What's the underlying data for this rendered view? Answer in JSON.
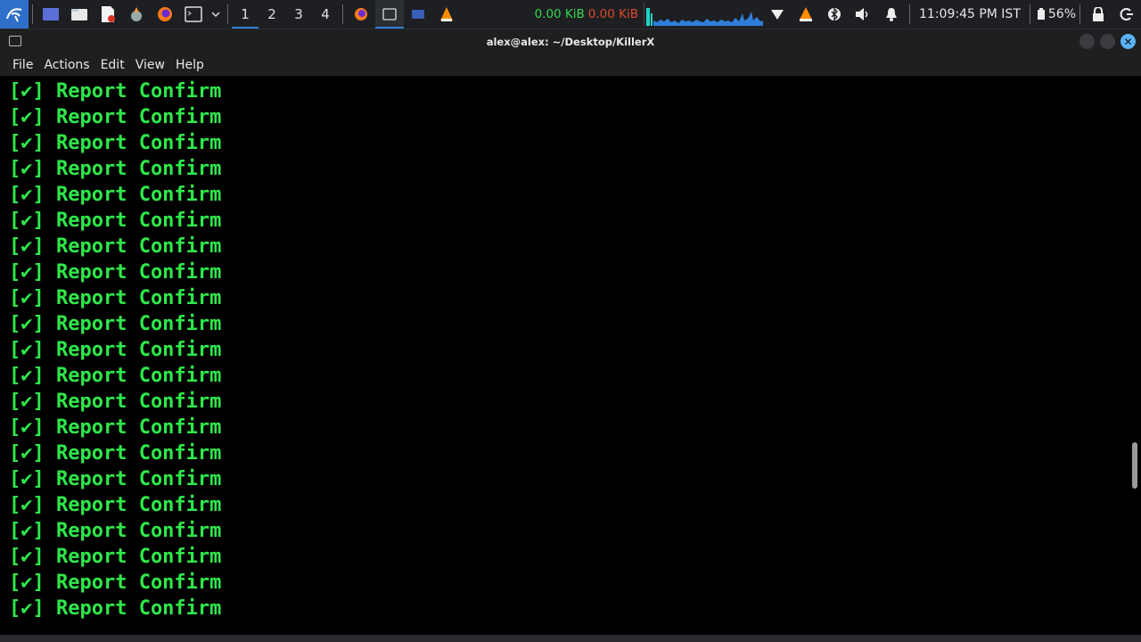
{
  "panel": {
    "workspaces": [
      "1",
      "2",
      "3",
      "4"
    ],
    "active_workspace": "1",
    "net_up": "0.00 KiB",
    "net_down": "0.00 KiB",
    "clock": "11:09:45 PM IST",
    "battery": "56%",
    "colors": {
      "accent": "#2f7fd9",
      "net_up": "#35d64e",
      "net_down": "#e04a2f"
    }
  },
  "window": {
    "title": "alex@alex: ~/Desktop/KillerX"
  },
  "menu": [
    "File",
    "Actions",
    "Edit",
    "View",
    "Help"
  ],
  "terminal": {
    "text_color": "#2ee84a",
    "lines": [
      "[✔] Report Confirm",
      "[✔] Report Confirm",
      "[✔] Report Confirm",
      "[✔] Report Confirm",
      "[✔] Report Confirm",
      "[✔] Report Confirm",
      "[✔] Report Confirm",
      "[✔] Report Confirm",
      "[✔] Report Confirm",
      "[✔] Report Confirm",
      "[✔] Report Confirm",
      "[✔] Report Confirm",
      "[✔] Report Confirm",
      "[✔] Report Confirm",
      "[✔] Report Confirm",
      "[✔] Report Confirm",
      "[✔] Report Confirm",
      "[✔] Report Confirm",
      "[✔] Report Confirm",
      "[✔] Report Confirm",
      "[✔] Report Confirm"
    ]
  }
}
